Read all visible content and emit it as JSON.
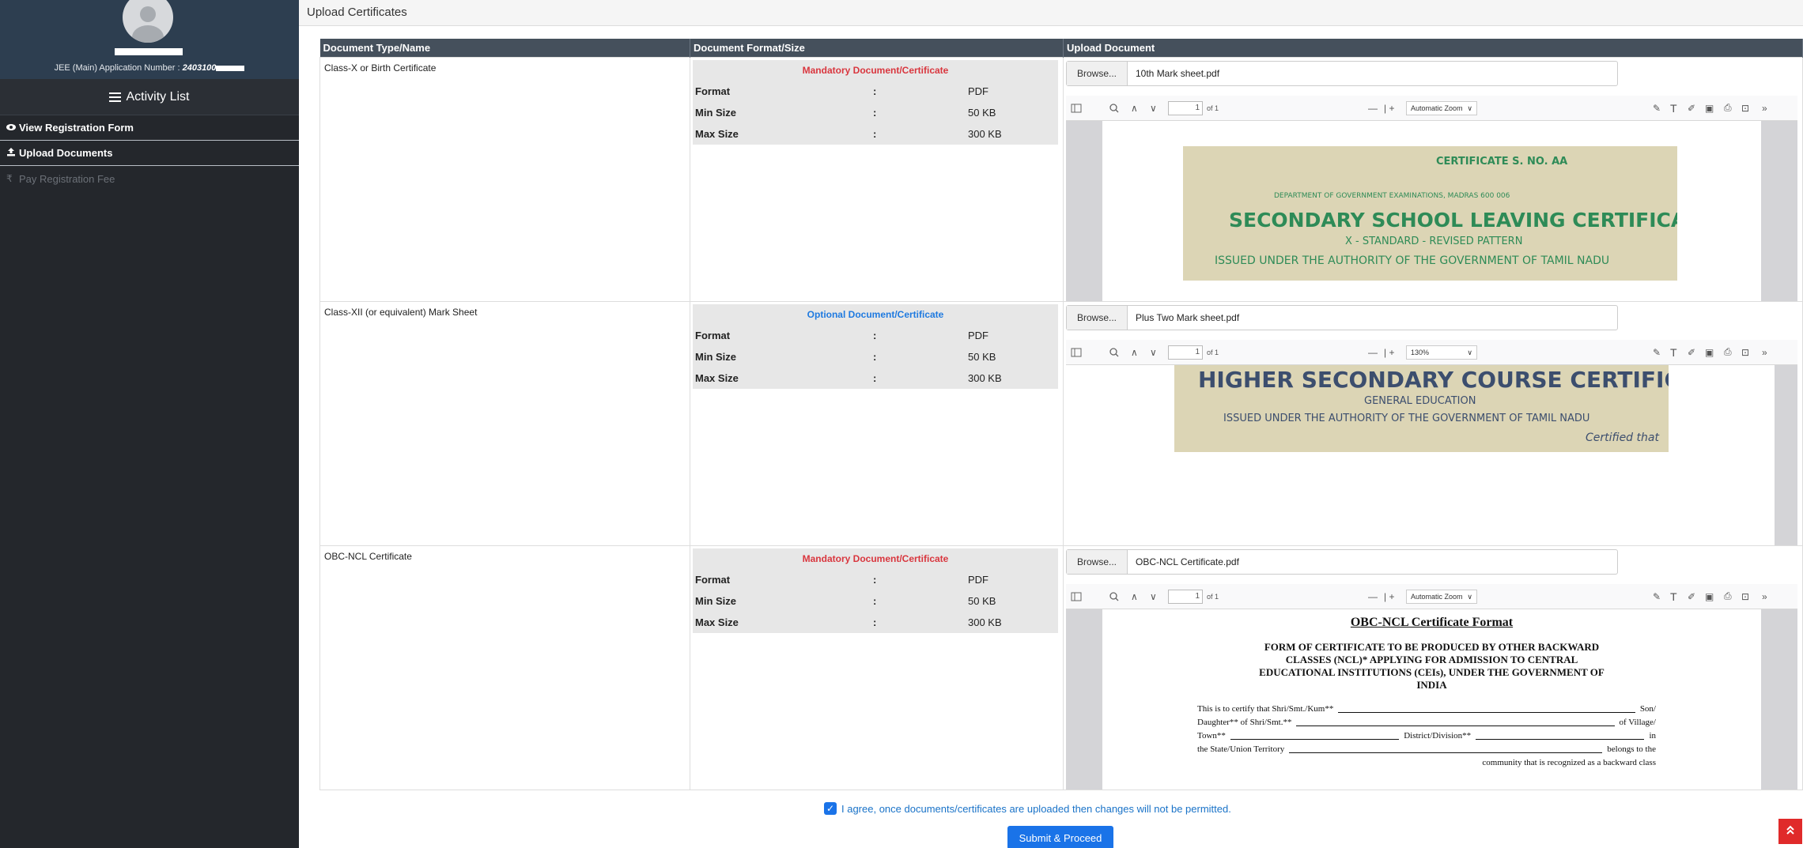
{
  "sidebar": {
    "app_label": "JEE (Main) Application Number : ",
    "app_number": "2403100",
    "activity_title": "Activity List",
    "items": [
      {
        "label": "View Registration Form",
        "icon": "eye-icon"
      },
      {
        "label": "Upload Documents",
        "icon": "upload-icon"
      },
      {
        "label": "Pay Registration Fee",
        "icon": "rupee-icon"
      }
    ]
  },
  "panel": {
    "title": "Upload Certificates"
  },
  "table": {
    "headers": [
      "Document Type/Name",
      "Document Format/Size",
      "Upload Document"
    ],
    "format_labels": {
      "format": "Format",
      "min": "Min Size",
      "max": "Max Size",
      "sep": ":"
    },
    "rows": [
      {
        "name": "Class-X or Birth Certificate",
        "category": "Mandatory Document/Certificate",
        "format": "PDF",
        "min_size": "50 KB",
        "max_size": "300 KB",
        "browse": "Browse...",
        "file": "10th Mark sheet.pdf",
        "viewer": {
          "page": "1",
          "of": "of 1",
          "zoom": "Automatic Zoom"
        },
        "preview": {
          "no": "CERTIFICATE S. NO. AA",
          "dept": "DEPARTMENT OF GOVERNMENT EXAMINATIONS, MADRAS 600 006",
          "title": "SECONDARY SCHOOL LEAVING CERTIFICATE",
          "sub": "X - STANDARD - REVISED PATTERN",
          "auth": "ISSUED UNDER THE AUTHORITY OF THE GOVERNMENT OF TAMIL NADU"
        }
      },
      {
        "name": "Class-XII (or equivalent) Mark Sheet",
        "category": "Optional Document/Certificate",
        "format": "PDF",
        "min_size": "50 KB",
        "max_size": "300 KB",
        "browse": "Browse...",
        "file": "Plus Two Mark sheet.pdf",
        "viewer": {
          "page": "1",
          "of": "of 1",
          "zoom": "130%"
        },
        "preview": {
          "title": "HIGHER SECONDARY COURSE CERTIFICATE",
          "sub": "GENERAL EDUCATION",
          "auth": "ISSUED UNDER THE AUTHORITY OF THE GOVERNMENT OF TAMIL NADU",
          "cert": "Certified that"
        }
      },
      {
        "name": "OBC-NCL Certificate",
        "category": "Mandatory Document/Certificate",
        "format": "PDF",
        "min_size": "50 KB",
        "max_size": "300 KB",
        "browse": "Browse...",
        "file": "OBC-NCL Certificate.pdf",
        "viewer": {
          "page": "1",
          "of": "of 1",
          "zoom": "Automatic Zoom"
        },
        "preview": {
          "heading": "OBC-NCL Certificate Format",
          "form_l1": "FORM OF CERTIFICATE TO BE PRODUCED BY OTHER BACKWARD",
          "form_l2": "CLASSES (NCL)* APPLYING FOR ADMISSION TO CENTRAL",
          "form_l3": "EDUCATIONAL INSTITUTIONS (CEIs), UNDER THE GOVERNMENT OF",
          "form_l4": "INDIA",
          "b1_a": "This is to certify that Shri/Smt./Kum**",
          "b1_b": "Son/",
          "b2_a": "Daughter**  of  Shri/Smt.**",
          "b2_b": "of  Village/",
          "b3_a": "Town**",
          "b3_m": "District/Division**",
          "b3_b": "in",
          "b4_a": "the  State/Union  Territory",
          "b4_b": "belongs  to  the",
          "b5": "community that is recognized as a backward class"
        }
      }
    ]
  },
  "consent": {
    "text": "I agree, once documents/certificates are uploaded then changes will not be permitted.",
    "checked": true
  },
  "submit": {
    "label": "Submit & Proceed"
  },
  "colors": {
    "sidebar_bg": "#24272c",
    "header_bg": "#45505c",
    "mandatory": "#d9363e",
    "optional": "#1f7ae0",
    "primary": "#1a73e8"
  }
}
